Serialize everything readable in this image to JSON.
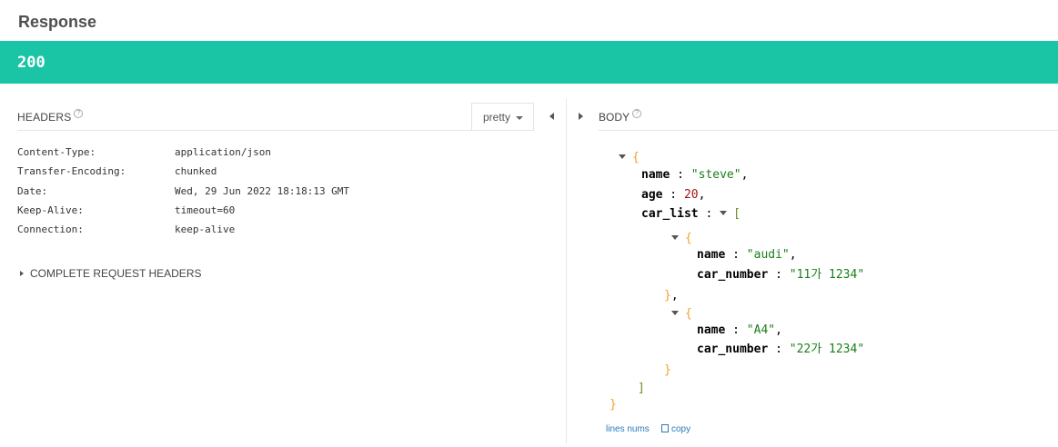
{
  "title": "Response",
  "status": {
    "code": "200",
    "color": "#1ac5a5"
  },
  "headers_panel": {
    "title": "HEADERS",
    "help_icon": "question-circle-icon",
    "format_select": "pretty",
    "rows": [
      {
        "key": "Content-Type:",
        "value": "application/json"
      },
      {
        "key": "Transfer-Encoding:",
        "value": "chunked"
      },
      {
        "key": "Date:",
        "value": "Wed, 29 Jun 2022 18:18:13 GMT"
      },
      {
        "key": "Keep-Alive:",
        "value": "timeout=60"
      },
      {
        "key": "Connection:",
        "value": "keep-alive"
      }
    ],
    "complete_headers_label": "COMPLETE REQUEST HEADERS"
  },
  "body_panel": {
    "title": "BODY",
    "json": {
      "open_brace": "{",
      "close_brace": "}",
      "name_key": "name",
      "name_value": "\"steve\"",
      "age_key": "age",
      "age_value": "20",
      "car_list_key": "car_list",
      "open_bracket": "[",
      "close_bracket": "]",
      "items": [
        {
          "name_key": "name",
          "name_value": "\"audi\"",
          "car_number_key": "car_number",
          "car_number_value": "\"11가 1234\""
        },
        {
          "name_key": "name",
          "name_value": "\"A4\"",
          "car_number_key": "car_number",
          "car_number_value": "\"22가 1234\""
        }
      ]
    },
    "footer": {
      "line_nums": "lines nums",
      "copy": "copy"
    }
  }
}
